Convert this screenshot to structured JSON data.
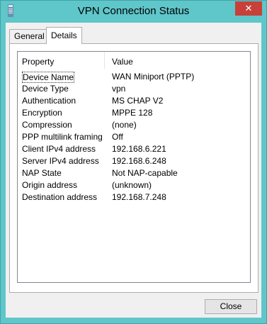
{
  "window": {
    "title": "VPN Connection Status"
  },
  "tabs": [
    {
      "label": "General"
    },
    {
      "label": "Details"
    }
  ],
  "table": {
    "headers": {
      "property": "Property",
      "value": "Value"
    },
    "rows": [
      {
        "property": "Device Name",
        "value": "WAN Miniport (PPTP)"
      },
      {
        "property": "Device Type",
        "value": "vpn"
      },
      {
        "property": "Authentication",
        "value": "MS CHAP V2"
      },
      {
        "property": "Encryption",
        "value": "MPPE 128"
      },
      {
        "property": "Compression",
        "value": "(none)"
      },
      {
        "property": "PPP multilink framing",
        "value": "Off"
      },
      {
        "property": "Client IPv4 address",
        "value": "192.168.6.221"
      },
      {
        "property": "Server IPv4 address",
        "value": "192.168.6.248"
      },
      {
        "property": "NAP State",
        "value": "Not NAP-capable"
      },
      {
        "property": "Origin address",
        "value": "(unknown)"
      },
      {
        "property": "Destination address",
        "value": "192.168.7.248"
      }
    ]
  },
  "buttons": {
    "close": "Close"
  },
  "icons": {
    "app": "network-connection-icon",
    "close": "close-icon"
  },
  "colors": {
    "frame": "#5fc6ca",
    "close_button": "#c7413a"
  }
}
